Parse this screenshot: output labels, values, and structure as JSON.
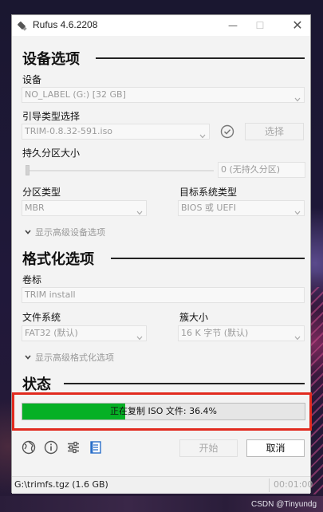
{
  "window": {
    "title": "Rufus 4.6.2208",
    "minimize": "—",
    "maximize": "☐",
    "close": "✕"
  },
  "device_section": {
    "title": "设备选项",
    "device_label": "设备",
    "device_value": "NO_LABEL (G:) [32 GB]",
    "boot_label": "引导类型选择",
    "boot_value": "TRIM-0.8.32-591.iso",
    "select_button": "选择",
    "persist_label": "持久分区大小",
    "persist_value": "0 (无持久分区)",
    "persist_level": 0,
    "partition_label": "分区类型",
    "partition_value": "MBR",
    "target_label": "目标系统类型",
    "target_value": "BIOS 或 UEFI",
    "advanced_toggle": "显示高级设备选项"
  },
  "format_section": {
    "title": "格式化选项",
    "volume_label": "卷标",
    "volume_value": "TRIM install",
    "fs_label": "文件系统",
    "fs_value": "FAT32 (默认)",
    "cluster_label": "簇大小",
    "cluster_value": "16 K 字节 (默认)",
    "advanced_toggle": "显示高级格式化选项"
  },
  "status_section": {
    "title": "状态",
    "progress_text": "正在复制 ISO 文件: 36.4%",
    "progress_fraction": 0.364
  },
  "toolbar": {
    "icons": [
      "globe-icon",
      "info-icon",
      "settings-sliders-icon",
      "log-icon"
    ],
    "start_button": "开始",
    "cancel_button": "取消"
  },
  "statusbar": {
    "left": "G:\\trimfs.tgz (1.6 GB)",
    "right": "00:01:00"
  },
  "watermark": "CSDN @Tinyundg",
  "colors": {
    "progress": "#06b025",
    "highlight": "#e12a1e"
  }
}
